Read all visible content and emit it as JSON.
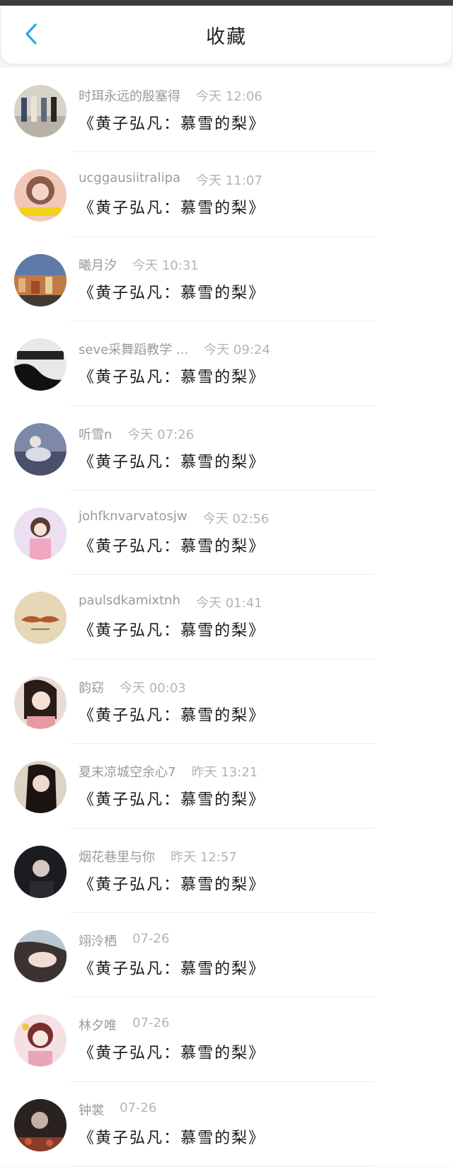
{
  "header": {
    "title": "收藏",
    "back_icon": "chevron-left-icon",
    "accent": "#29a8e8"
  },
  "items": [
    {
      "name": "时珥永远的殷塞得",
      "time": "今天 12:06",
      "work": "《黄子弘凡：慕雪的梨》"
    },
    {
      "name": "ucggausiitralipa",
      "time": "今天 11:07",
      "work": "《黄子弘凡：慕雪的梨》"
    },
    {
      "name": "曦月汐",
      "time": "今天 10:31",
      "work": "《黄子弘凡：慕雪的梨》"
    },
    {
      "name": "seve采舞蹈教学 ...",
      "time": "今天 09:24",
      "work": "《黄子弘凡：慕雪的梨》"
    },
    {
      "name": "听雪n",
      "time": "今天 07:26",
      "work": "《黄子弘凡：慕雪的梨》"
    },
    {
      "name": "johfknvarvatosjw",
      "time": "今天 02:56",
      "work": "《黄子弘凡：慕雪的梨》"
    },
    {
      "name": "paulsdkamixtnh",
      "time": "今天 01:41",
      "work": "《黄子弘凡：慕雪的梨》"
    },
    {
      "name": "韵窈",
      "time": "今天 00:03",
      "work": "《黄子弘凡：慕雪的梨》"
    },
    {
      "name": "夏末凉城空余心7",
      "time": "昨天 13:21",
      "work": "《黄子弘凡：慕雪的梨》"
    },
    {
      "name": "烟花巷里与你",
      "time": "昨天 12:57",
      "work": "《黄子弘凡：慕雪的梨》"
    },
    {
      "name": "翊泠栖",
      "time": "07-26",
      "work": "《黄子弘凡：慕雪的梨》"
    },
    {
      "name": "林夕唯",
      "time": "07-26",
      "work": "《黄子弘凡：慕雪的梨》"
    },
    {
      "name": "钟裳",
      "time": "07-26",
      "work": "《黄子弘凡：慕雪的梨》"
    }
  ]
}
